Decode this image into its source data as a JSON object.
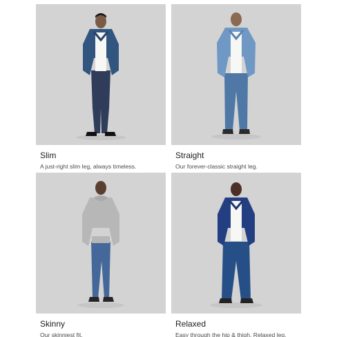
{
  "products": [
    {
      "name": "Slim",
      "description": "A just-right slim leg, always timeless."
    },
    {
      "name": "Straight",
      "description": "Our forever-classic straight leg."
    },
    {
      "name": "Skinny",
      "description": "Our skinniest fit."
    },
    {
      "name": "Relaxed",
      "description": "Easy through the hip & thigh. Relaxed leg."
    }
  ],
  "colors": {
    "background": "#ffffff",
    "image_background": "#d3d3d3",
    "title_text": "#1d1d1d",
    "description_text": "#4a4a4a"
  }
}
